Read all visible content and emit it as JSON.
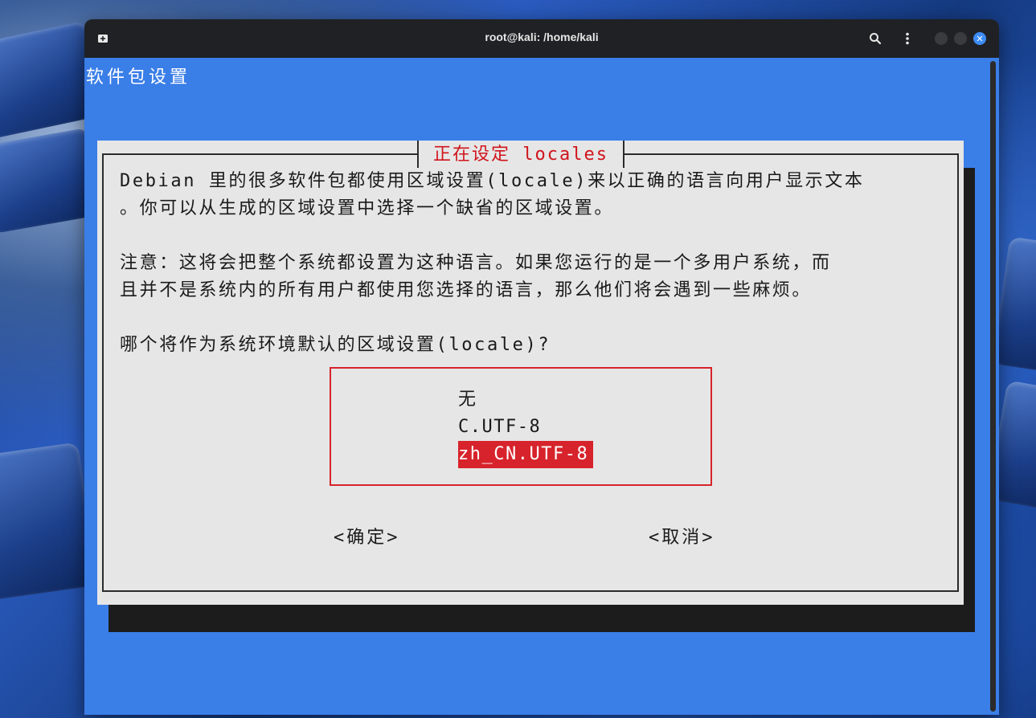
{
  "window": {
    "title": "root@kali: /home/kali"
  },
  "icons": {
    "new_tab": "new-tab-icon",
    "search": "search-icon",
    "menu": "kebab-menu-icon",
    "minimize": "minimize-icon",
    "maximize": "maximize-icon",
    "close": "close-icon"
  },
  "colors": {
    "terminal_bg": "#3a7ee8",
    "dialog_bg": "#e6e6e6",
    "accent_red": "#d7232b",
    "titlebar": "#202124"
  },
  "backtitle": "软件包设置",
  "dialog": {
    "title": "正在设定 locales",
    "paragraphs": [
      "Debian 里的很多软件包都使用区域设置(locale)来以正确的语言向用户显示文本",
      "。你可以从生成的区域设置中选择一个缺省的区域设置。",
      "注意：这将会把整个系统都设置为这种语言。如果您运行的是一个多用户系统，而",
      "且并不是系统内的所有用户都使用您选择的语言，那么他们将会遇到一些麻烦。",
      "哪个将作为系统环境默认的区域设置(locale)?"
    ],
    "options": [
      {
        "label": "无"
      },
      {
        "label": "C.UTF-8"
      },
      {
        "label": "zh_CN.UTF-8"
      }
    ],
    "selected_index": 2,
    "ok_label": "<确定>",
    "cancel_label": "<取消>"
  }
}
